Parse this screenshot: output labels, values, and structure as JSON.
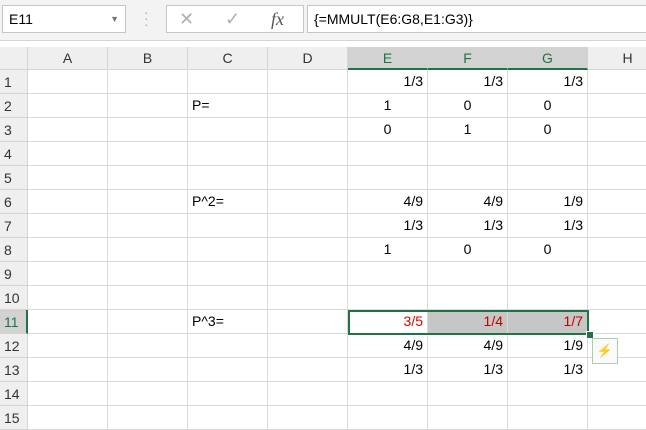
{
  "name_box": "E11",
  "formula_bar": {
    "cancel_icon": "✕",
    "enter_icon": "✓",
    "fx_label": "fx",
    "formula": "{=MMULT(E6:G8,E1:G3)}"
  },
  "columns": [
    "A",
    "B",
    "C",
    "D",
    "E",
    "F",
    "G",
    "H"
  ],
  "rows": [
    "1",
    "2",
    "3",
    "4",
    "5",
    "6",
    "7",
    "8",
    "9",
    "10",
    "11",
    "12",
    "13",
    "14",
    "15"
  ],
  "cells": {
    "E1": "1/3",
    "F1": "1/3",
    "G1": "1/3",
    "C2": "P=",
    "E2": "1",
    "F2": "0",
    "G2": "0",
    "E3": "0",
    "F3": "1",
    "G3": "0",
    "C6": "P^2=",
    "E6": "4/9",
    "F6": "4/9",
    "G6": "1/9",
    "E7": "1/3",
    "F7": "1/3",
    "G7": "1/3",
    "E8": "1",
    "F8": "0",
    "G8": "0",
    "C11": "P^3=",
    "E11": "3/5",
    "F11": "1/4",
    "G11": "1/7",
    "E12": "4/9",
    "F12": "4/9",
    "G12": "1/9",
    "E13": "1/3",
    "F13": "1/3",
    "G13": "1/3"
  },
  "accent": "#217346"
}
